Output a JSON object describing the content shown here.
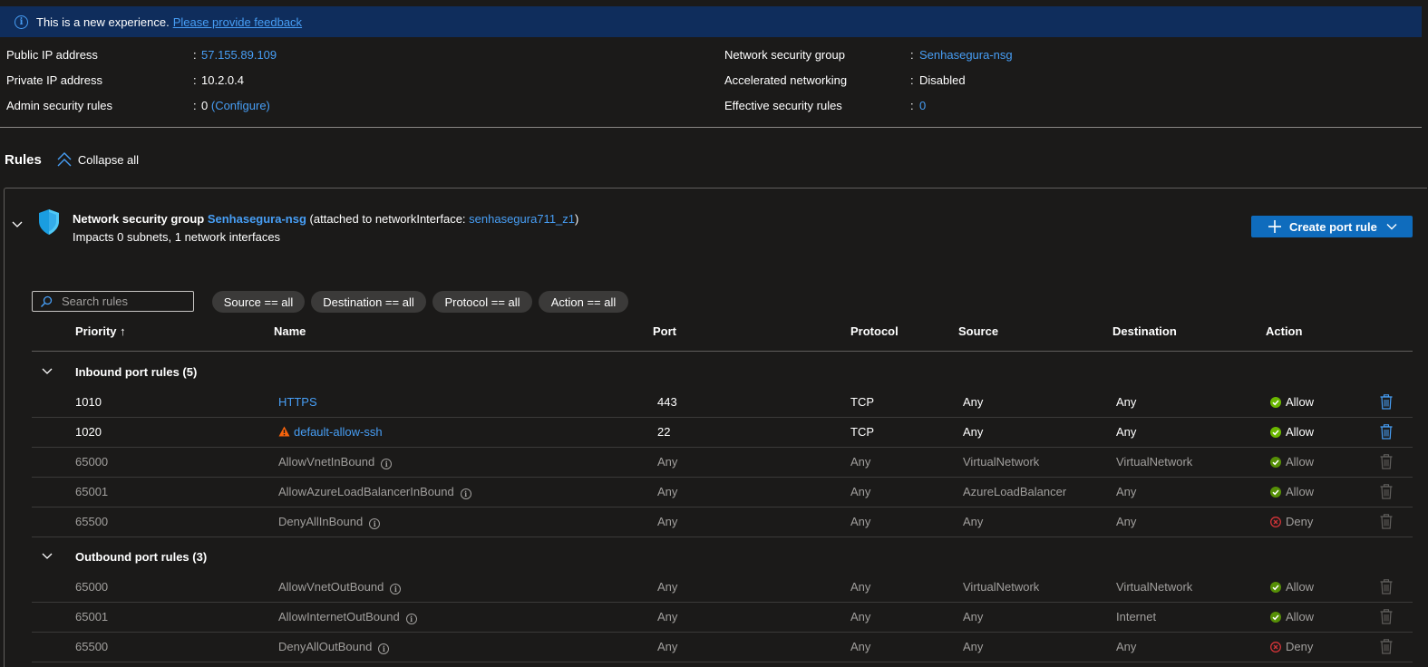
{
  "banner": {
    "message": "This is a new experience.",
    "feedback_link": "Please provide feedback"
  },
  "properties": {
    "public_ip": {
      "label": "Public IP address",
      "value": "57.155.89.109"
    },
    "private_ip": {
      "label": "Private IP address",
      "value": "10.2.0.4"
    },
    "admin_rules": {
      "label": "Admin security rules",
      "value": "0",
      "link": "(Configure)"
    },
    "nsg": {
      "label": "Network security group",
      "value": "Senhasegura-nsg"
    },
    "accel": {
      "label": "Accelerated networking",
      "value": "Disabled"
    },
    "effective": {
      "label": "Effective security rules",
      "value": "0"
    },
    "colon": ":"
  },
  "rules": {
    "title": "Rules",
    "collapse_label": "Collapse all"
  },
  "nsg_card": {
    "prefix": "Network security group",
    "name": "Senhasegura-nsg",
    "attached_open": "(attached to networkInterface:",
    "interface": "senhasegura711_z1",
    "attached_close": ")",
    "subtitle": "Impacts 0 subnets, 1 network interfaces",
    "create_button": "Create port rule"
  },
  "filters": {
    "search_placeholder": "Search rules",
    "source": "Source == all",
    "destination": "Destination == all",
    "protocol": "Protocol == all",
    "action": "Action == all"
  },
  "columns": {
    "priority": "Priority ↑",
    "name": "Name",
    "port": "Port",
    "protocol": "Protocol",
    "source": "Source",
    "destination": "Destination",
    "action": "Action"
  },
  "inbound": {
    "title": "Inbound port rules (5)",
    "rows": [
      {
        "priority": "1010",
        "name": "HTTPS",
        "port": "443",
        "protocol": "TCP",
        "source": "Any",
        "destination": "Any",
        "action": "Allow"
      },
      {
        "priority": "1020",
        "name": "default-allow-ssh",
        "port": "22",
        "protocol": "TCP",
        "source": "Any",
        "destination": "Any",
        "action": "Allow"
      },
      {
        "priority": "65000",
        "name": "AllowVnetInBound",
        "port": "Any",
        "protocol": "Any",
        "source": "VirtualNetwork",
        "destination": "VirtualNetwork",
        "action": "Allow"
      },
      {
        "priority": "65001",
        "name": "AllowAzureLoadBalancerInBound",
        "port": "Any",
        "protocol": "Any",
        "source": "AzureLoadBalancer",
        "destination": "Any",
        "action": "Allow"
      },
      {
        "priority": "65500",
        "name": "DenyAllInBound",
        "port": "Any",
        "protocol": "Any",
        "source": "Any",
        "destination": "Any",
        "action": "Deny"
      }
    ]
  },
  "outbound": {
    "title": "Outbound port rules (3)",
    "rows": [
      {
        "priority": "65000",
        "name": "AllowVnetOutBound",
        "port": "Any",
        "protocol": "Any",
        "source": "VirtualNetwork",
        "destination": "VirtualNetwork",
        "action": "Allow"
      },
      {
        "priority": "65001",
        "name": "AllowInternetOutBound",
        "port": "Any",
        "protocol": "Any",
        "source": "Any",
        "destination": "Internet",
        "action": "Allow"
      },
      {
        "priority": "65500",
        "name": "DenyAllOutBound",
        "port": "Any",
        "protocol": "Any",
        "source": "Any",
        "destination": "Any",
        "action": "Deny"
      }
    ]
  },
  "colors": {
    "accent": "#479ef5",
    "primary_button": "#0f6cbd",
    "allow": "#6bb700",
    "deny": "#d13438",
    "warning": "#f7630c",
    "banner_bg": "#0f2d5c"
  }
}
